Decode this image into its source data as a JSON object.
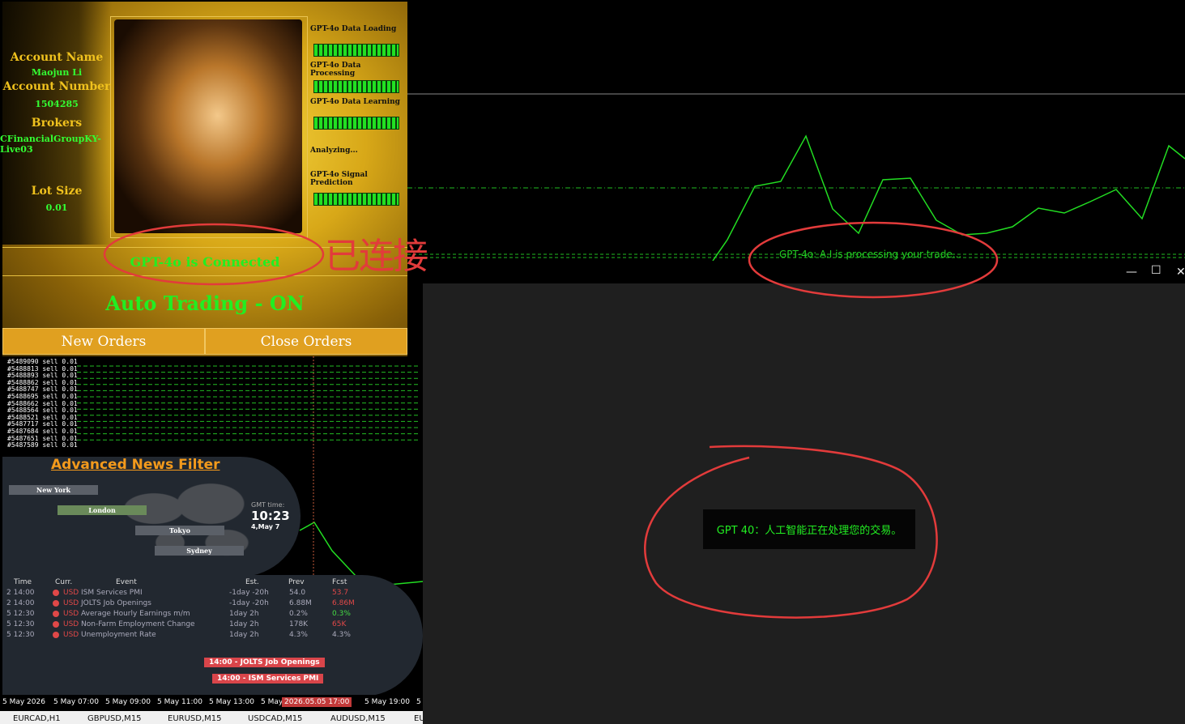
{
  "panel": {
    "account_name_label": "Account Name",
    "account_name": "Maojun Li",
    "account_number_label": "Account Number",
    "account_number": "1504285",
    "brokers_label": "Brokers",
    "broker": "CFinancialGroupKY-Live03",
    "lot_size_label": "Lot Size",
    "lot_size": "0.01",
    "progress": [
      {
        "label": "GPT-4o Data Loading",
        "level": 1.0
      },
      {
        "label": "GPT-4o Data Processing",
        "level": 0.9
      },
      {
        "label": "GPT-4o Data Learning",
        "level": 1.0
      },
      {
        "label": "Analyzing...",
        "level": null
      },
      {
        "label": "GPT-4o Signal Prediction",
        "level": 0.85
      }
    ],
    "connected": "GPT-4o is Connected",
    "auto_trading": "Auto Trading - ON",
    "new_orders": "New Orders",
    "close_orders": "Close Orders"
  },
  "annotation_connected_cn": "已连接",
  "orders": [
    "#5489090 sell 0.01",
    "#5488813 sell 0.01",
    "#5488893 sell 0.01",
    "#5488862 sell 0.01",
    "#5488747 sell 0.01",
    "#5488695 sell 0.01",
    "#5488662 sell 0.01",
    "#5488564 sell 0.01",
    "#5488521 sell 0.01",
    "#5487717 sell 0.01",
    "#5487684 sell 0.01",
    "#5487651 sell 0.01",
    "#5487589 sell 0.01"
  ],
  "news": {
    "title": "Advanced News Filter",
    "sessions": [
      "New York",
      "London",
      "Tokyo",
      "Sydney"
    ],
    "gmt_label": "GMT time:",
    "gmt_time": "10:23",
    "gmt_date": "4,May 7",
    "headers": [
      "Time",
      "Curr.",
      "Event",
      "Est.",
      "Prev",
      "Fcst"
    ],
    "rows": [
      {
        "time": "2 14:00",
        "curr": "USD",
        "event": "ISM Services PMI",
        "est": "-1day -20h",
        "prev": "54.0",
        "fcst": "53.7",
        "fcst_color": "#e04848"
      },
      {
        "time": "2 14:00",
        "curr": "USD",
        "event": "JOLTS Job Openings",
        "est": "-1day -20h",
        "prev": "6.88M",
        "fcst": "6.86M",
        "fcst_color": "#e04848"
      },
      {
        "time": "5 12:30",
        "curr": "USD",
        "event": "Average Hourly Earnings m/m",
        "est": "1day 2h",
        "prev": "0.2%",
        "fcst": "0.3%",
        "fcst_color": "#44dd44"
      },
      {
        "time": "5 12:30",
        "curr": "USD",
        "event": "Non-Farm Employment Change",
        "est": "1day 2h",
        "prev": "178K",
        "fcst": "65K",
        "fcst_color": "#e04848"
      },
      {
        "time": "5 12:30",
        "curr": "USD",
        "event": "Unemployment Rate",
        "est": "1day 2h",
        "prev": "4.3%",
        "fcst": "4.3%",
        "fcst_color": "#aab"
      }
    ],
    "flags": [
      "14:00 - JOLTS Job Openings",
      "14:00 - ISM Services PMI"
    ]
  },
  "time_axis": [
    "5 May 2026",
    "5 May 07:00",
    "5 May 09:00",
    "5 May 11:00",
    "5 May 13:00",
    "5 May",
    "5 May 19:00",
    "5"
  ],
  "time_highlight": "2026.05.05 17:00",
  "tabs": [
    "EURCAD,H1",
    "GBPUSD,M15",
    "EURUSD,M15",
    "USDCAD,M15",
    "AUDUSD,M15",
    "EU"
  ],
  "chart_processing_text": "GPT-4o: A.I is processing your trade...",
  "dark_window": {
    "minimize": "—",
    "maximize": "☐",
    "close": "✕",
    "message": "GPT 40：人工智能正在处理您的交易。"
  },
  "colors": {
    "line": "#22dd22",
    "gold": "#e0a020",
    "annotation": "#e23b3b"
  }
}
